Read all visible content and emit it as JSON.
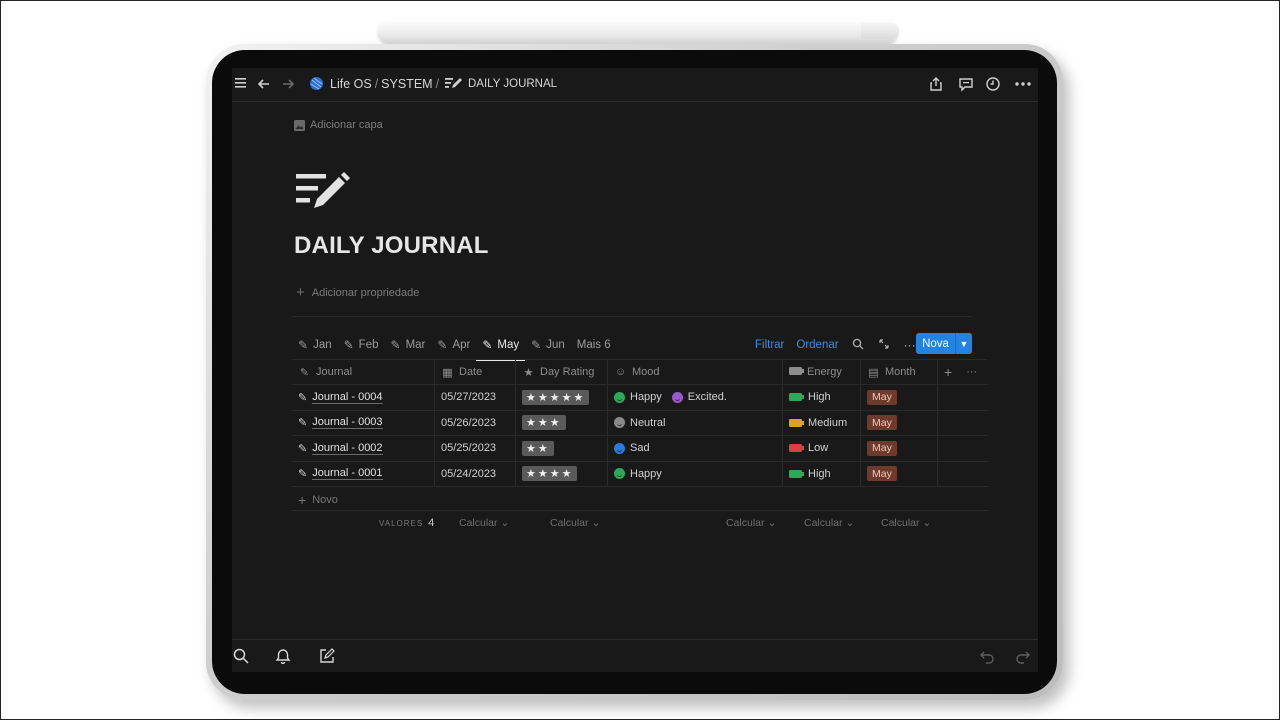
{
  "topbar": {
    "workspace": "Life OS",
    "section": "SYSTEM",
    "page": "DAILY JOURNAL",
    "icons": [
      "menu-icon",
      "back-arrow-icon",
      "forward-arrow-icon",
      "share-icon",
      "comment-icon",
      "clock-icon",
      "more-icon"
    ]
  },
  "page": {
    "add_cover": "Adicionar capa",
    "title": "DAILY JOURNAL",
    "add_property": "Adicionar propriedade"
  },
  "tabs": {
    "items": [
      {
        "label": "Jan",
        "active": false
      },
      {
        "label": "Feb",
        "active": false
      },
      {
        "label": "Mar",
        "active": false
      },
      {
        "label": "Apr",
        "active": false
      },
      {
        "label": "May",
        "active": true
      },
      {
        "label": "Jun",
        "active": false
      }
    ],
    "more": "Mais 6"
  },
  "toolbar": {
    "filter": "Filtrar",
    "sort": "Ordenar",
    "new_button": "Nova"
  },
  "table": {
    "columns": [
      {
        "label": "Journal",
        "icon": "edit-icon"
      },
      {
        "label": "Date",
        "icon": "calendar-icon"
      },
      {
        "label": "Day Rating",
        "icon": "star-icon"
      },
      {
        "label": "Mood",
        "icon": "smiley-icon"
      },
      {
        "label": "Energy",
        "icon": "battery-icon"
      },
      {
        "label": "Month",
        "icon": "calendar-page-icon"
      }
    ],
    "rows": [
      {
        "journal": "Journal - 0004",
        "date": "05/27/2023",
        "rating": "★★★★★",
        "moods": [
          {
            "label": "Happy",
            "color": "#2fa85a"
          },
          {
            "label": "Excited.",
            "color": "#9b59d0"
          }
        ],
        "energy": {
          "label": "High",
          "color": "#2fa85a"
        },
        "month": "May"
      },
      {
        "journal": "Journal - 0003",
        "date": "05/26/2023",
        "rating": "★★★",
        "moods": [
          {
            "label": "Neutral",
            "color": "#8a8a8a"
          }
        ],
        "energy": {
          "label": "Medium",
          "color": "#e0a020"
        },
        "month": "May"
      },
      {
        "journal": "Journal - 0002",
        "date": "05/25/2023",
        "rating": "★★",
        "moods": [
          {
            "label": "Sad",
            "color": "#2f7ad6"
          }
        ],
        "energy": {
          "label": "Low",
          "color": "#d94040"
        },
        "month": "May"
      },
      {
        "journal": "Journal - 0001",
        "date": "05/24/2023",
        "rating": "★★★★",
        "moods": [
          {
            "label": "Happy",
            "color": "#2fa85a"
          }
        ],
        "energy": {
          "label": "High",
          "color": "#2fa85a"
        },
        "month": "May"
      }
    ],
    "new_row": "Novo",
    "footer": {
      "values_label": "VALORES",
      "values_count": "4",
      "calc": "Calcular"
    }
  },
  "colors": {
    "accent": "#2383e2",
    "background": "#191919",
    "month_tag": "#6e3a2b"
  }
}
